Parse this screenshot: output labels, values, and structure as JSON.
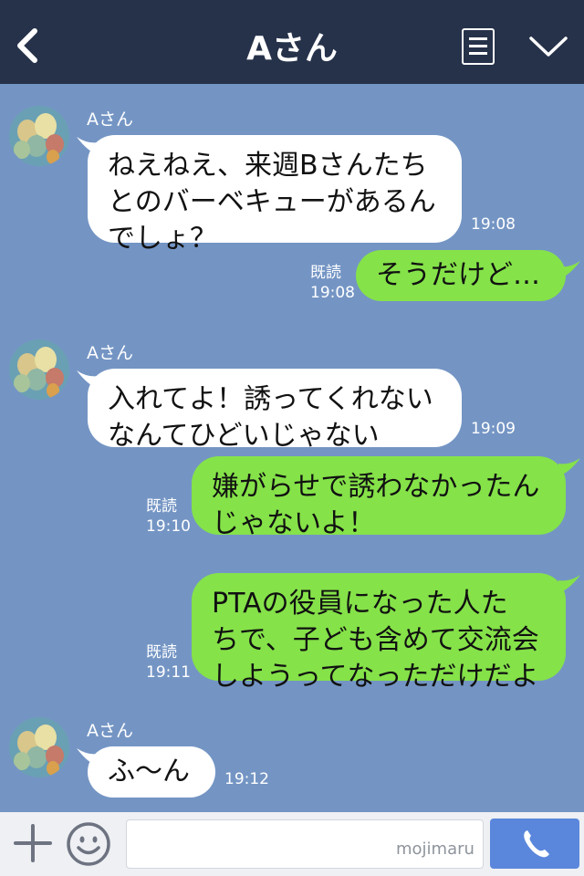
{
  "header": {
    "title": "Aさん"
  },
  "messages": [
    {
      "sender": "Aさん",
      "text": "ねえねえ、来週Bさんたち\nとのバーベキューがあるん\nでしょ？",
      "time": "19:08"
    },
    {
      "text": "そうだけど…",
      "read": "既読",
      "time": "19:08"
    },
    {
      "sender": "Aさん",
      "text": "入れてよ！誘ってくれない\nなんてひどいじゃない",
      "time": "19:09"
    },
    {
      "text": "嫌がらせで誘わなかったん\nじゃないよ！",
      "read": "既読",
      "time": "19:10"
    },
    {
      "text": "PTAの役員になった人た\nちで、子ども含めて交流会\nしようってなっただけだよ",
      "read": "既読",
      "time": "19:11"
    },
    {
      "sender": "Aさん",
      "text": "ふ〜ん",
      "time": "19:12"
    }
  ],
  "bottom": {
    "watermark": "mojimaru"
  },
  "colors": {
    "background": "#7495c4",
    "header": "#26324a",
    "outgoing_bubble": "#85e249",
    "incoming_bubble": "#ffffff",
    "call_button": "#5a87dc"
  },
  "icons": {
    "back": "chevron-left-icon",
    "menu": "menu-list-icon",
    "collapse": "chevron-down-icon",
    "add": "plus-icon",
    "emoji": "smile-icon",
    "call": "phone-icon"
  }
}
